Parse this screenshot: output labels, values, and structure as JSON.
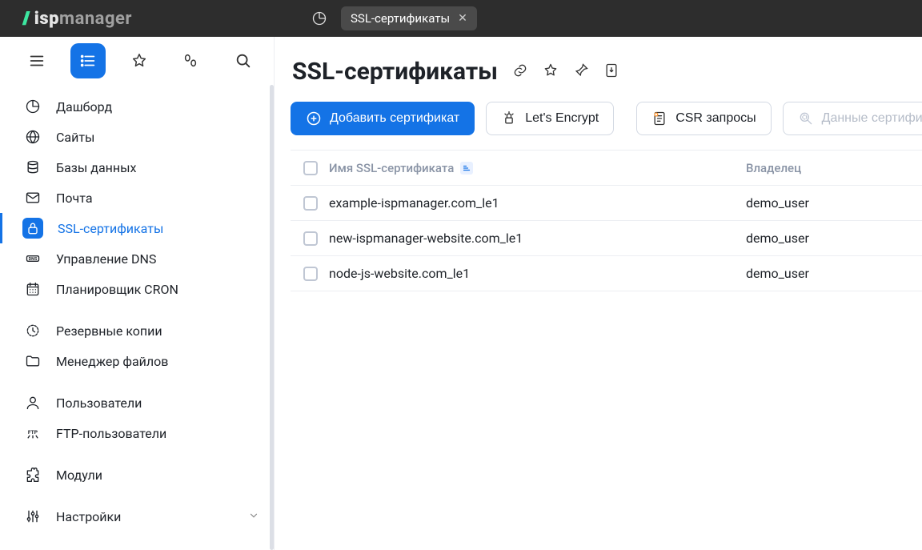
{
  "brand": {
    "name_strong": "isp",
    "name_light": "manager"
  },
  "topbar": {
    "tab_label": "SSL-сертификаты"
  },
  "sidebar": {
    "items": [
      {
        "icon": "dashboard",
        "label": "Дашборд"
      },
      {
        "icon": "globe",
        "label": "Сайты"
      },
      {
        "icon": "database",
        "label": "Базы данных"
      },
      {
        "icon": "mail",
        "label": "Почта"
      },
      {
        "icon": "lock",
        "label": "SSL-сертификаты",
        "active": true
      },
      {
        "icon": "dns",
        "label": "Управление DNS"
      },
      {
        "icon": "calendar",
        "label": "Планировщик CRON"
      },
      {
        "sep": true
      },
      {
        "icon": "backup",
        "label": "Резервные копии"
      },
      {
        "icon": "folder",
        "label": "Менеджер файлов"
      },
      {
        "sep": true
      },
      {
        "icon": "user",
        "label": "Пользователи"
      },
      {
        "icon": "ftp",
        "label": "FTP-пользователи"
      },
      {
        "sep": true
      },
      {
        "icon": "puzzle",
        "label": "Модули"
      },
      {
        "sep": true
      },
      {
        "icon": "sliders",
        "label": "Настройки",
        "expandable": true
      }
    ]
  },
  "page": {
    "title": "SSL-сертификаты"
  },
  "toolbar": {
    "add_label": "Добавить сертификат",
    "lets_encrypt_label": "Let's Encrypt",
    "csr_label": "CSR запросы",
    "cert_data_label": "Данные сертификата"
  },
  "table": {
    "columns": {
      "name": "Имя SSL-сертификата",
      "owner": "Владелец"
    },
    "rows": [
      {
        "name": "example-ispmanager.com_le1",
        "owner": "demo_user"
      },
      {
        "name": "new-ispmanager-website.com_le1",
        "owner": "demo_user"
      },
      {
        "name": "node-js-website.com_le1",
        "owner": "demo_user"
      }
    ]
  }
}
